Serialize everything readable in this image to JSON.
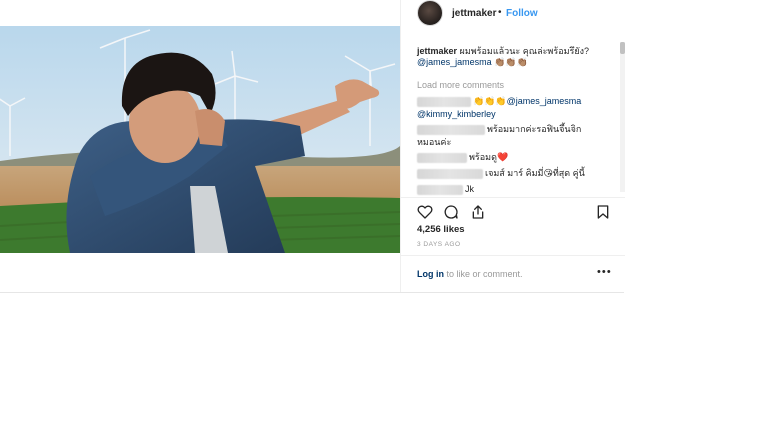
{
  "post": {
    "username": "jettmaker",
    "separator": "•",
    "follow_label": "Follow",
    "caption_user": "jettmaker",
    "caption_text": "ผมพร้อมแล้วนะ คุณล่ะพร้อมรึยัง?",
    "caption_mention": "@james_jamesma",
    "caption_emoji": "👏🏽👏🏽👏🏽",
    "load_more": "Load more comments",
    "comments": [
      {
        "emoji": "👏👏👏",
        "mention": "@james_jamesma",
        "text": ""
      },
      {
        "emoji": "",
        "mention": "@kimmy_kimberley",
        "text": ""
      },
      {
        "emoji": "",
        "mention": "",
        "text": "พร้อมมากค่ะรอฟินจึ้นจิก"
      },
      {
        "emoji": "",
        "mention": "",
        "text": "หมอนค่ะ"
      },
      {
        "emoji": "❤️",
        "mention": "",
        "text": "พร้อมดู"
      },
      {
        "emoji": "😘",
        "mention": "",
        "text": "เจมส์ มาร์ คิมมี่",
        "text2": "ที่สุด คู่นี้"
      },
      {
        "emoji": "",
        "mention": "",
        "text": "Jk"
      }
    ],
    "likes": "4,256 likes",
    "time": "3 DAYS AGO",
    "login_link": "Log in",
    "login_rest": " to like or comment.",
    "more_icon": "more-options-icon"
  },
  "icons": {
    "like": "heart-icon",
    "comment": "comment-bubble-icon",
    "share": "share-icon",
    "save": "bookmark-icon"
  },
  "colors": {
    "link_blue": "#3897f0",
    "mention_navy": "#003569",
    "muted_gray": "#999999"
  }
}
